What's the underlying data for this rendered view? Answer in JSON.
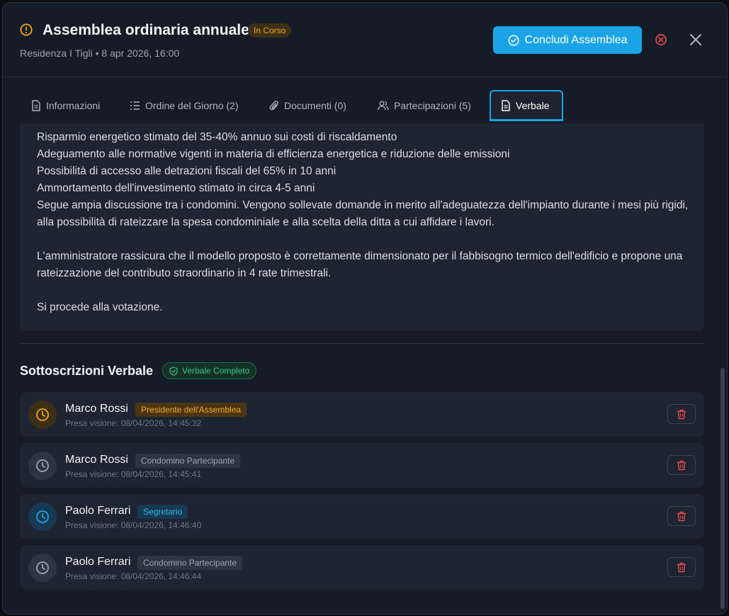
{
  "header": {
    "title": "Assemblea ordinaria annuale",
    "status": "In Corso",
    "subtitle": "Residenza I Tigli • 8 apr 2026, 16:00",
    "primary_action": "Concludi Assemblea"
  },
  "tabs": [
    {
      "label": "Informazioni",
      "icon": "document-icon"
    },
    {
      "label": "Ordine del Giorno (2)",
      "icon": "list-icon"
    },
    {
      "label": "Documenti (0)",
      "icon": "paperclip-icon"
    },
    {
      "label": "Partecipazioni (5)",
      "icon": "users-icon"
    },
    {
      "label": "Verbale",
      "icon": "document-icon",
      "active": true
    }
  ],
  "minutes": {
    "lines": [
      "Risparmio energetico stimato del 35-40% annuo sui costi di riscaldamento",
      "Adeguamento alle normative vigenti in materia di efficienza energetica e riduzione delle emissioni",
      "Possibilità di accesso alle detrazioni fiscali del 65% in 10 anni",
      "Ammortamento dell'investimento stimato in circa 4-5 anni",
      "Segue ampia discussione tra i condomini. Vengono sollevate domande in merito all'adeguatezza dell'impianto durante i mesi più rigidi, alla possibilità di rateizzare la spesa condominiale e alla scelta della ditta a cui affidare i lavori.",
      "L'amministratore rassicura che il modello proposto è correttamente dimensionato per il fabbisogno termico dell'edificio e propone una rateizzazione del contributo straordinario in 4 rate trimestrali.",
      "Si procede alla votazione."
    ]
  },
  "signatures": {
    "title": "Sottoscrizioni Verbale",
    "badge": "Verbale Completo",
    "items": [
      {
        "name": "Marco Rossi",
        "role": "Presidente dell'Assemblea",
        "seen": "Presa visione: 08/04/2026, 14:45:32"
      },
      {
        "name": "Marco Rossi",
        "role": "Condomino Partecipante",
        "seen": "Presa visione: 08/04/2026, 14:45:41"
      },
      {
        "name": "Paolo Ferrari",
        "role": "Segretario",
        "seen": "Presa visione: 08/04/2026, 14:46:40"
      },
      {
        "name": "Paolo Ferrari",
        "role": "Condomino Partecipante",
        "seen": "Presa visione: 08/04/2026, 14:46:44"
      }
    ]
  },
  "colors": {
    "accent": "#1ba3e8",
    "warning": "#f5a524",
    "success": "#38c98a",
    "danger": "#e5484d"
  }
}
